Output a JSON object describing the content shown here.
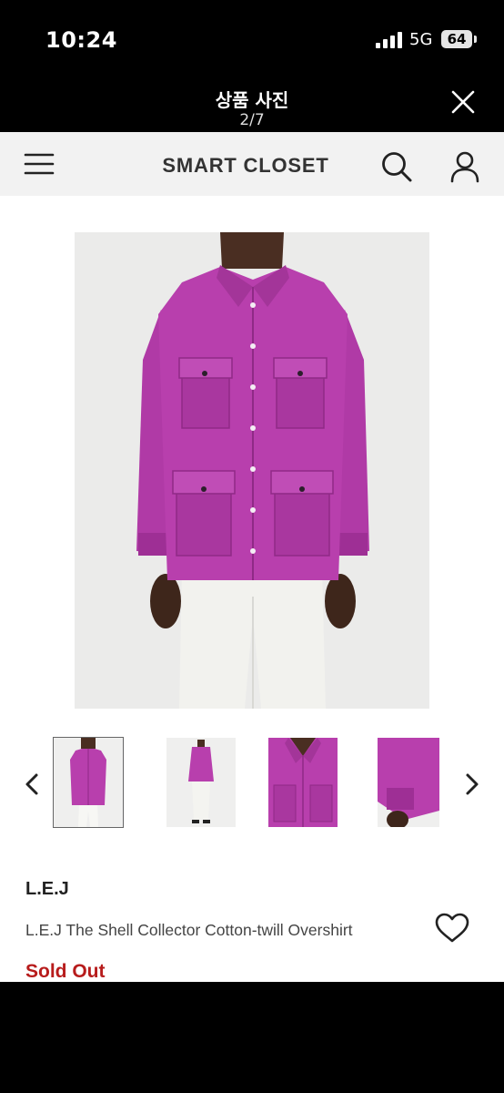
{
  "status_bar": {
    "time": "10:24",
    "network": "5G",
    "battery": "64"
  },
  "photo_viewer": {
    "title": "상품 사진",
    "counter": "2/7"
  },
  "store": {
    "brand_header": "SMART CLOSET"
  },
  "product": {
    "brand": "L.E.J",
    "title": "L.E.J The Shell Collector Cotton-twill Overshirt",
    "stock_status": "Sold Out",
    "shirt_color": "#b03aa6",
    "stock_status_color": "#b71c1c"
  },
  "gallery": {
    "thumbnail_count": 4,
    "selected_index": 0
  },
  "icons": [
    "signal-icon",
    "close-icon",
    "menu-icon",
    "search-icon",
    "account-icon",
    "chevron-left-icon",
    "chevron-right-icon",
    "heart-icon"
  ]
}
